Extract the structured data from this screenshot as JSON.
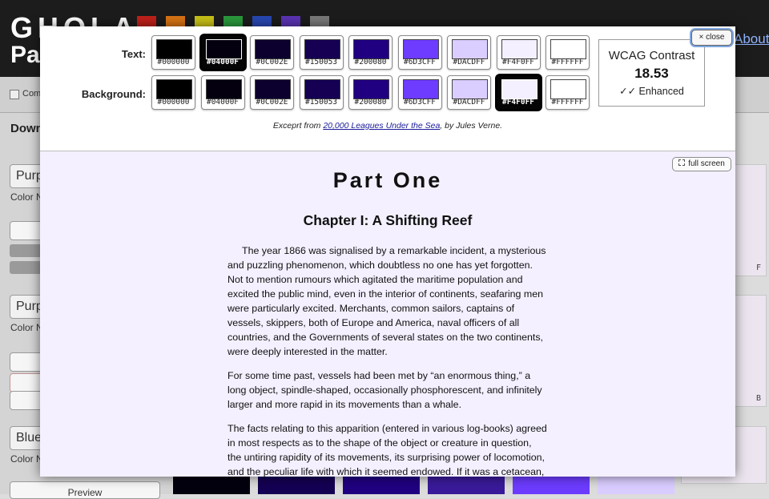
{
  "background_app": {
    "logo_top": "GHOLA",
    "logo_bottom": "Pal",
    "about_link": "About",
    "swatch_colors": [
      "#c0211a",
      "#d87413",
      "#c9c218",
      "#2a9a3d",
      "#2848b3",
      "#5b34b4",
      "#7a7a7a"
    ],
    "toolbar_check_label": "Com",
    "panel_heading": "Down",
    "palette_names": [
      "Purp",
      "Purp",
      "Blue"
    ],
    "field_label": "Color N",
    "preview_button": "Preview",
    "card_labels": [
      "F",
      "B"
    ]
  },
  "modal": {
    "text_row_label": "Text:",
    "background_row_label": "Background:",
    "text_swatches": [
      {
        "hex": "#000000",
        "selected": false
      },
      {
        "hex": "#04000F",
        "selected": true
      },
      {
        "hex": "#0C002E",
        "selected": false
      },
      {
        "hex": "#150053",
        "selected": false
      },
      {
        "hex": "#200080",
        "selected": false
      },
      {
        "hex": "#6D3CFF",
        "selected": false
      },
      {
        "hex": "#DACDFF",
        "selected": false
      },
      {
        "hex": "#F4F0FF",
        "selected": false
      },
      {
        "hex": "#FFFFFF",
        "selected": false
      }
    ],
    "background_swatches": [
      {
        "hex": "#000000",
        "selected": false
      },
      {
        "hex": "#04000F",
        "selected": false
      },
      {
        "hex": "#0C002E",
        "selected": false
      },
      {
        "hex": "#150053",
        "selected": false
      },
      {
        "hex": "#200080",
        "selected": false
      },
      {
        "hex": "#6D3CFF",
        "selected": false
      },
      {
        "hex": "#DACDFF",
        "selected": false
      },
      {
        "hex": "#F4F0FF",
        "selected": true
      },
      {
        "hex": "#FFFFFF",
        "selected": false
      }
    ],
    "wcag": {
      "title": "WCAG Contrast",
      "value": "18.53",
      "level": "✓✓ Enhanced"
    },
    "close_label": "× close",
    "caption_prefix": "Exceprt from ",
    "caption_link": "20,000 Leagues Under the Sea",
    "caption_suffix": ", by Jules Verne.",
    "fullscreen_label": "full screen"
  },
  "reader": {
    "part_title": "Part One",
    "chapter_title": "Chapter I: A Shifting Reef",
    "paragraphs": [
      "The year 1866 was signalised by a remarkable incident, a mysterious and puzzling phenomenon, which doubtless no one has yet forgotten. Not to mention rumours which agitated the maritime population and excited the public mind, even in the interior of continents, seafaring men were particularly excited. Merchants, common sailors, captains of vessels, skippers, both of Europe and America, naval officers of all countries, and the Governments of several states on the two continents, were deeply interested in the matter.",
      "For some time past, vessels had been met by “an enormous thing,” a long object, spindle-shaped, occasionally phosphorescent, and infinitely larger and more rapid in its movements than a whale.",
      "The facts relating to this apparition (entered in various log-books) agreed in most respects as to the shape of the object or creature in question, the untiring rapidity of its movements, its surprising power of locomotion, and the peculiar life with which it seemed endowed. If it was a cetacean, it"
    ],
    "text_color": "#04000F",
    "background_color": "#F4F0FF"
  }
}
